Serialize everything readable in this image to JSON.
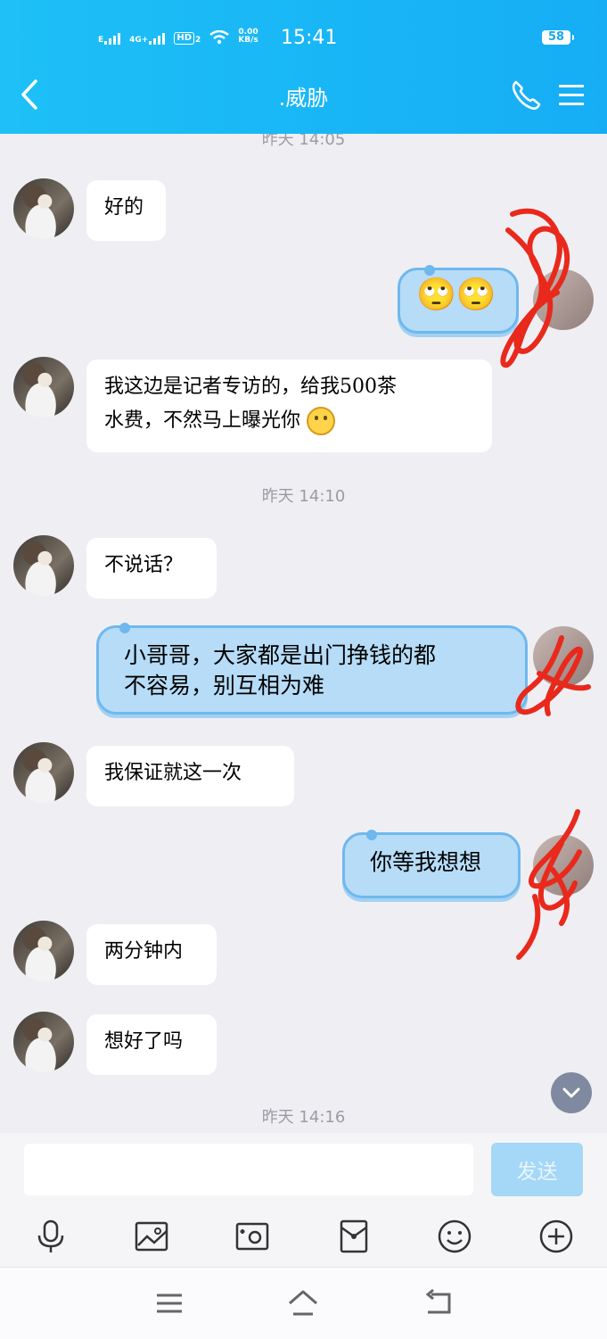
{
  "status_bar": {
    "network_e": "E",
    "network_4g": "4G+",
    "hd": "HD",
    "hd_sub": "2",
    "speed_value": "0.00",
    "speed_unit": "KB/s",
    "time": "15:41",
    "battery": "58"
  },
  "header": {
    "title": ".威胁"
  },
  "timestamps": [
    "昨天 14:05",
    "昨天 14:10",
    "昨天 14:16"
  ],
  "messages": [
    {
      "dir": "in",
      "text": "好的"
    },
    {
      "dir": "out",
      "text": "🙄🙄"
    },
    {
      "dir": "in",
      "line1": "我这边是记者专访的，给我500茶",
      "line2": "水费，不然马上曝光你"
    },
    {
      "dir": "in",
      "text": "不说话？"
    },
    {
      "dir": "out",
      "line1": "小哥哥，大家都是出门挣钱的都",
      "line2": "不容易，别互相为难"
    },
    {
      "dir": "in",
      "text": "我保证就这一次"
    },
    {
      "dir": "out",
      "text": "你等我想想"
    },
    {
      "dir": "in",
      "text": "两分钟内"
    },
    {
      "dir": "in",
      "text": "想好了吗"
    }
  ],
  "composer": {
    "input_value": "",
    "send_label": "发送"
  },
  "colors": {
    "header": "#19b7f6",
    "outgoing_bubble": "#b6dcf7",
    "annotation_red": "#e8291c"
  },
  "icons": [
    "back-arrow-icon",
    "phone-icon",
    "menu-icon",
    "microphone-icon",
    "image-icon",
    "camera-icon",
    "red-packet-icon",
    "emoji-icon",
    "plus-icon",
    "chevron-down-icon"
  ]
}
